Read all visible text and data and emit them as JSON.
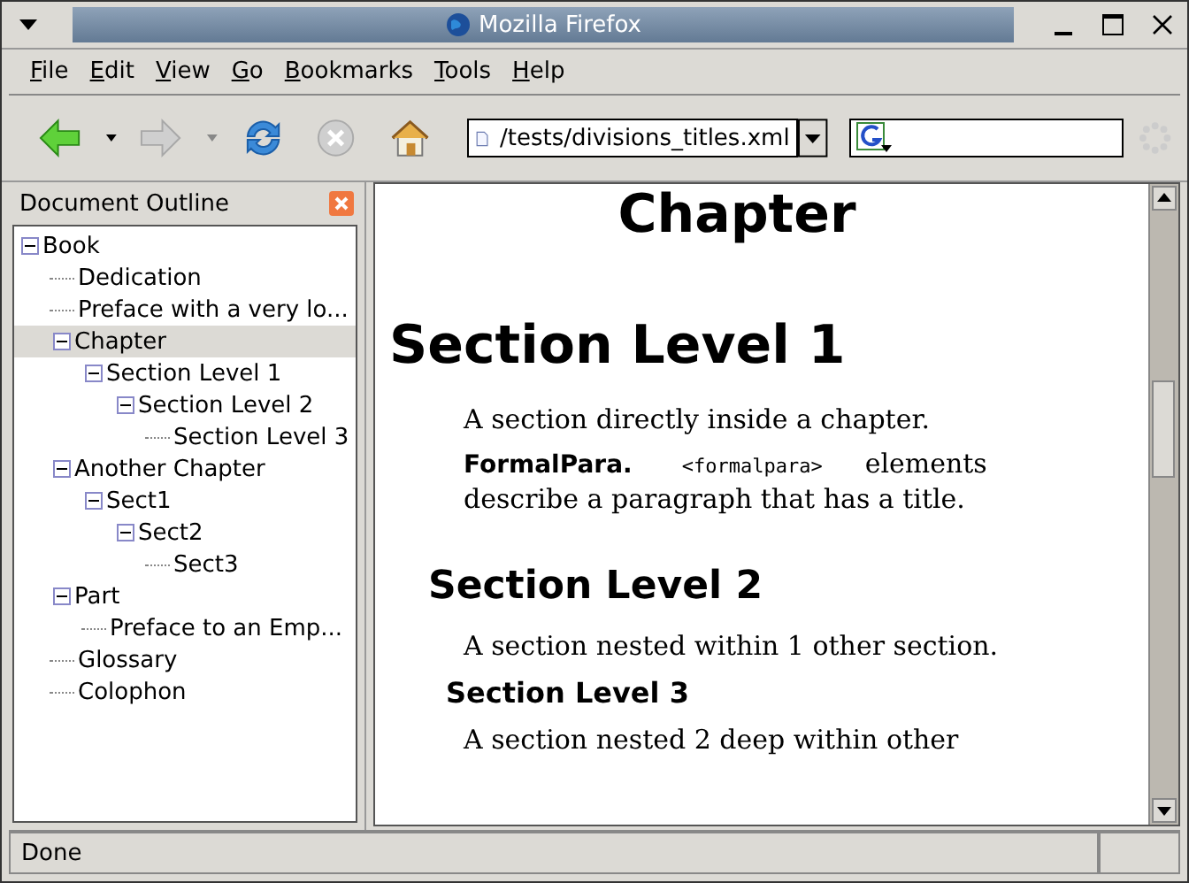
{
  "window": {
    "title": "Mozilla Firefox"
  },
  "menu": [
    "File",
    "Edit",
    "View",
    "Go",
    "Bookmarks",
    "Tools",
    "Help"
  ],
  "toolbar": {
    "back_disabled": false,
    "forward_disabled": true,
    "stop_disabled": true,
    "address": "/tests/divisions_titles.xml"
  },
  "sidebar": {
    "title": "Document Outline",
    "tree": [
      {
        "label": "Book",
        "expanded": true,
        "selected": false,
        "children": [
          {
            "label": "Dedication",
            "selected": false
          },
          {
            "label": "Preface with a very lo...",
            "selected": false
          },
          {
            "label": "Chapter",
            "expanded": true,
            "selected": true,
            "children": [
              {
                "label": "Section Level 1",
                "expanded": true,
                "selected": false,
                "children": [
                  {
                    "label": "Section Level 2",
                    "expanded": true,
                    "selected": false,
                    "children": [
                      {
                        "label": "Section Level 3",
                        "selected": false
                      }
                    ]
                  }
                ]
              }
            ]
          },
          {
            "label": "Another Chapter",
            "expanded": true,
            "selected": false,
            "children": [
              {
                "label": "Sect1",
                "expanded": true,
                "selected": false,
                "children": [
                  {
                    "label": "Sect2",
                    "expanded": true,
                    "selected": false,
                    "children": [
                      {
                        "label": "Sect3",
                        "selected": false
                      }
                    ]
                  }
                ]
              }
            ]
          },
          {
            "label": "Part",
            "expanded": true,
            "selected": false,
            "children": [
              {
                "label": "Preface to an Emp...",
                "selected": false
              }
            ]
          },
          {
            "label": "Glossary",
            "selected": false
          },
          {
            "label": "Colophon",
            "selected": false
          }
        ]
      }
    ]
  },
  "content": [
    {
      "kind": "title",
      "text": "Chapter"
    },
    {
      "kind": "h1",
      "text": "Section Level 1"
    },
    {
      "kind": "para",
      "text": "A section directly inside a chapter."
    },
    {
      "kind": "formalpara",
      "title": "FormalPara.",
      "code": "<formalpara>",
      "text": "elements describe a paragraph that has a title."
    },
    {
      "kind": "h2",
      "text": "Section Level 2"
    },
    {
      "kind": "para",
      "text": "A section nested within 1 other section."
    },
    {
      "kind": "h3",
      "text": "Section Level 3"
    },
    {
      "kind": "para",
      "text": "A section nested 2 deep within other"
    }
  ],
  "status_bar": {
    "text": "Done"
  }
}
